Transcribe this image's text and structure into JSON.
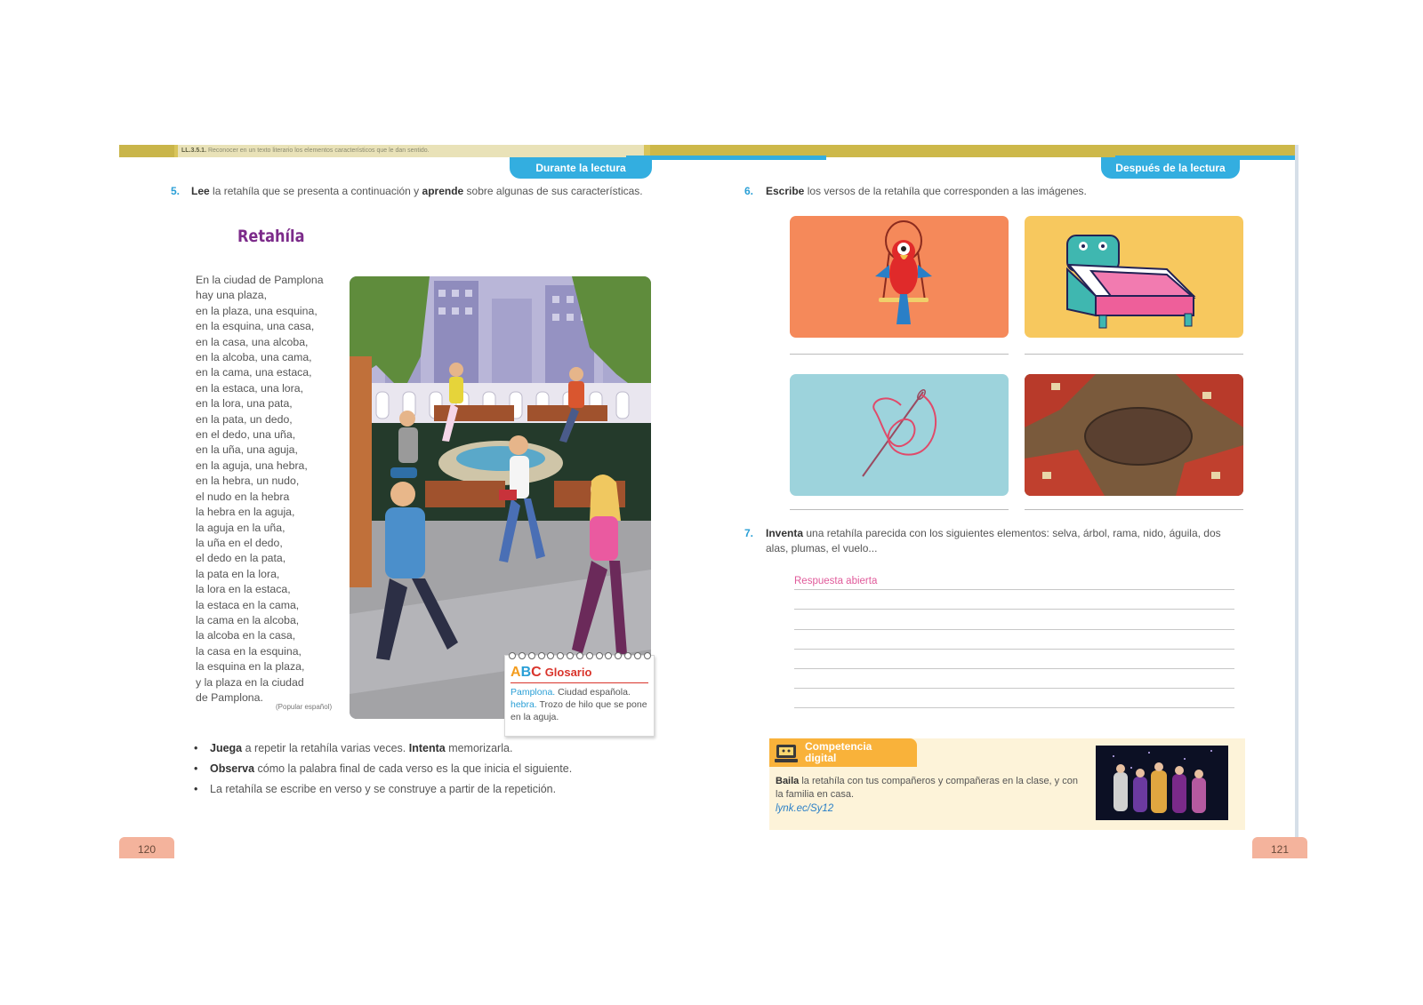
{
  "header": {
    "code_label": "LL.3.5.1.",
    "code_text": "Reconocer en un texto literario los elementos característicos que le dan sentido.",
    "tab_left": "Durante la lectura",
    "tab_right": "Después de la lectura"
  },
  "left_page": {
    "q5_num": "5.",
    "q5_lee": "Lee",
    "q5_mid": " la retahíla que se presenta a continuación y ",
    "q5_aprende": "aprende",
    "q5_end": " sobre algunas de sus características.",
    "title": "Retahíla",
    "poem": [
      "En la ciudad de Pamplona",
      "hay una plaza,",
      "en la plaza, una esquina,",
      "en la esquina, una casa,",
      "en la casa, una alcoba,",
      "en la alcoba, una cama,",
      "en la cama, una estaca,",
      "en la estaca, una lora,",
      "en la lora, una pata,",
      "en la pata, un dedo,",
      "en el dedo, una uña,",
      "en la uña, una aguja,",
      "en la aguja, una hebra,",
      "en la hebra, un nudo,",
      "el nudo en la hebra",
      "la hebra en la aguja,",
      "la aguja en la uña,",
      "la uña en el dedo,",
      "el dedo en la pata,",
      "la pata en la lora,",
      "la lora en la estaca,",
      "la estaca en la cama,",
      "la cama en la alcoba,",
      "la alcoba en la casa,",
      "la casa en la esquina,",
      "la esquina en la plaza,",
      "y la plaza en la ciudad",
      "de Pamplona."
    ],
    "source": "(Popular español)",
    "glossary": {
      "title": "Glosario",
      "abc_a": "A",
      "abc_b": "B",
      "abc_c": "C",
      "term1": "Pamplona.",
      "def1": " Ciudad española.",
      "term2": "hebra.",
      "def2": " Trozo de hilo que se pone en la aguja."
    },
    "bullets": [
      {
        "b1": "Juega",
        "t1": " a repetir la retahíla varias veces. ",
        "b2": "Intenta",
        "t2": " memorizarla."
      },
      {
        "b1": "Observa",
        "t1": " cómo la palabra final de cada verso es la que inicia el siguiente.",
        "b2": "",
        "t2": ""
      },
      {
        "b1": "",
        "t1": "La retahíla se escribe en verso y se construye a partir de la repetición.",
        "b2": "",
        "t2": ""
      }
    ],
    "page_number": "120"
  },
  "right_page": {
    "q6_num": "6.",
    "q6_bold": "Escribe",
    "q6_text": " los versos de la retahíla que corresponden a las imágenes.",
    "q7_num": "7.",
    "q7_bold": "Inventa",
    "q7_text": " una retahíla parecida con los siguientes elementos: selva, árbol, rama, nido, águila, dos alas, plumas, el vuelo...",
    "answer_hint": "Respuesta abierta",
    "digital": {
      "tag_line1": "Competencia",
      "tag_line2": "digital",
      "bold": "Baila",
      "text": " la retahíla con tus compañeros y compañeras en la clase, y con la familia en casa.",
      "link": "lynk.ec/Sy12"
    },
    "page_number": "121"
  },
  "colors": {
    "accent_blue": "#33aee0",
    "title_purple": "#7c2b8a",
    "gold_bar": "#d8c45a",
    "answer_pink": "#e05a9a",
    "glossary_red": "#d9342b"
  }
}
